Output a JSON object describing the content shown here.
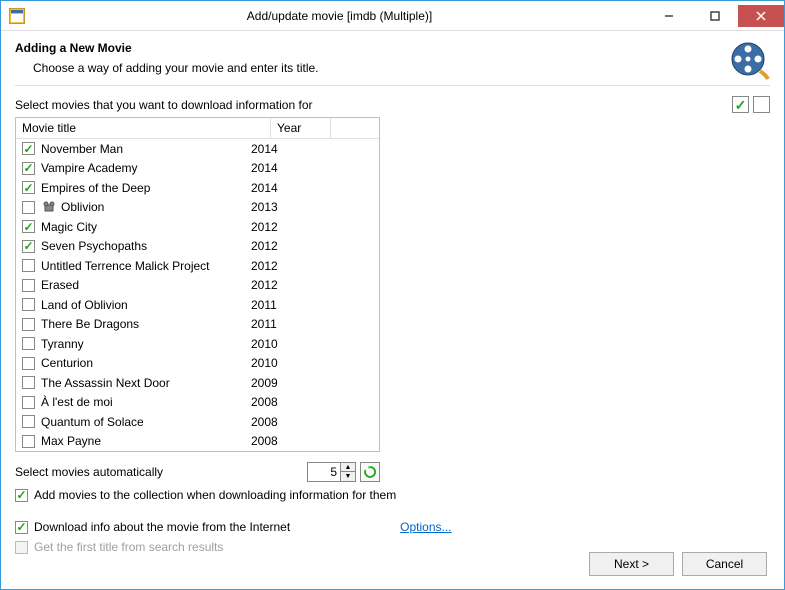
{
  "window": {
    "title": "Add/update movie [imdb (Multiple)]"
  },
  "header": {
    "heading": "Adding a New Movie",
    "subtext": "Choose a way of adding your movie and enter its title."
  },
  "select_bar": {
    "label": "Select movies that you want to download information for"
  },
  "columns": {
    "movie": "Movie title",
    "year": "Year"
  },
  "rows": [
    {
      "checked": true,
      "flag": false,
      "title": "November Man",
      "year": "2014"
    },
    {
      "checked": true,
      "flag": false,
      "title": "Vampire Academy",
      "year": "2014"
    },
    {
      "checked": true,
      "flag": false,
      "title": "Empires of the Deep",
      "year": "2014"
    },
    {
      "checked": false,
      "flag": true,
      "title": "Oblivion",
      "year": "2013"
    },
    {
      "checked": true,
      "flag": false,
      "title": "Magic City",
      "year": "2012"
    },
    {
      "checked": true,
      "flag": false,
      "title": "Seven Psychopaths",
      "year": "2012"
    },
    {
      "checked": false,
      "flag": false,
      "title": "Untitled Terrence Malick Project",
      "year": "2012"
    },
    {
      "checked": false,
      "flag": false,
      "title": "Erased",
      "year": "2012"
    },
    {
      "checked": false,
      "flag": false,
      "title": "Land of Oblivion",
      "year": "2011"
    },
    {
      "checked": false,
      "flag": false,
      "title": "There Be Dragons",
      "year": "2011"
    },
    {
      "checked": false,
      "flag": false,
      "title": "Tyranny",
      "year": "2010"
    },
    {
      "checked": false,
      "flag": false,
      "title": "Centurion",
      "year": "2010"
    },
    {
      "checked": false,
      "flag": false,
      "title": "The Assassin Next Door",
      "year": "2009"
    },
    {
      "checked": false,
      "flag": false,
      "title": "À l'est de moi",
      "year": "2008"
    },
    {
      "checked": false,
      "flag": false,
      "title": "Quantum of Solace",
      "year": "2008"
    },
    {
      "checked": false,
      "flag": false,
      "title": "Max Payne",
      "year": "2008"
    }
  ],
  "auto": {
    "label": "Select movies automatically",
    "value": "5"
  },
  "opts": {
    "add_collection": "Add movies to the collection when downloading information for them",
    "download_info": "Download info about the movie from the Internet",
    "first_title": "Get the first title from search results",
    "options_link": "Options..."
  },
  "buttons": {
    "next": "Next >",
    "cancel": "Cancel"
  }
}
